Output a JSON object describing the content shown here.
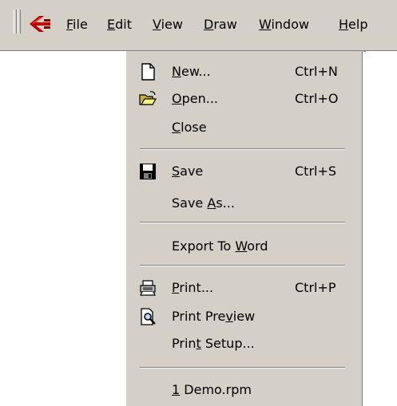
{
  "menubar": {
    "logo_icon": "app-logo-icon",
    "items": [
      {
        "pre": "",
        "key": "F",
        "post": "ile"
      },
      {
        "pre": "",
        "key": "E",
        "post": "dit"
      },
      {
        "pre": "",
        "key": "V",
        "post": "iew"
      },
      {
        "pre": "",
        "key": "D",
        "post": "raw"
      },
      {
        "pre": "",
        "key": "W",
        "post": "indow"
      },
      {
        "pre": "",
        "key": "H",
        "post": "elp"
      }
    ]
  },
  "file_menu": {
    "items": [
      {
        "icon": "new-document-icon",
        "pre": "",
        "key": "N",
        "post": "ew...",
        "shortcut": "Ctrl+N"
      },
      {
        "icon": "open-folder-icon",
        "pre": "",
        "key": "O",
        "post": "pen...",
        "shortcut": "Ctrl+O"
      },
      {
        "icon": "",
        "pre": "",
        "key": "C",
        "post": "lose",
        "shortcut": ""
      },
      {
        "icon": "floppy-disk-icon",
        "pre": "",
        "key": "S",
        "post": "ave",
        "shortcut": "Ctrl+S"
      },
      {
        "icon": "",
        "pre": "Save ",
        "key": "A",
        "post": "s...",
        "shortcut": ""
      },
      {
        "icon": "",
        "pre": "Export To ",
        "key": "W",
        "post": "ord",
        "shortcut": ""
      },
      {
        "icon": "printer-icon",
        "pre": "",
        "key": "P",
        "post": "rint...",
        "shortcut": "Ctrl+P"
      },
      {
        "icon": "print-preview-icon",
        "pre": "Print Pre",
        "key": "v",
        "post": "iew",
        "shortcut": ""
      },
      {
        "icon": "",
        "pre": "Prin",
        "key": "t",
        "post": " Setup...",
        "shortcut": ""
      },
      {
        "icon": "",
        "pre": "",
        "key": "1",
        "post": " Demo.rpm",
        "shortcut": ""
      }
    ]
  }
}
